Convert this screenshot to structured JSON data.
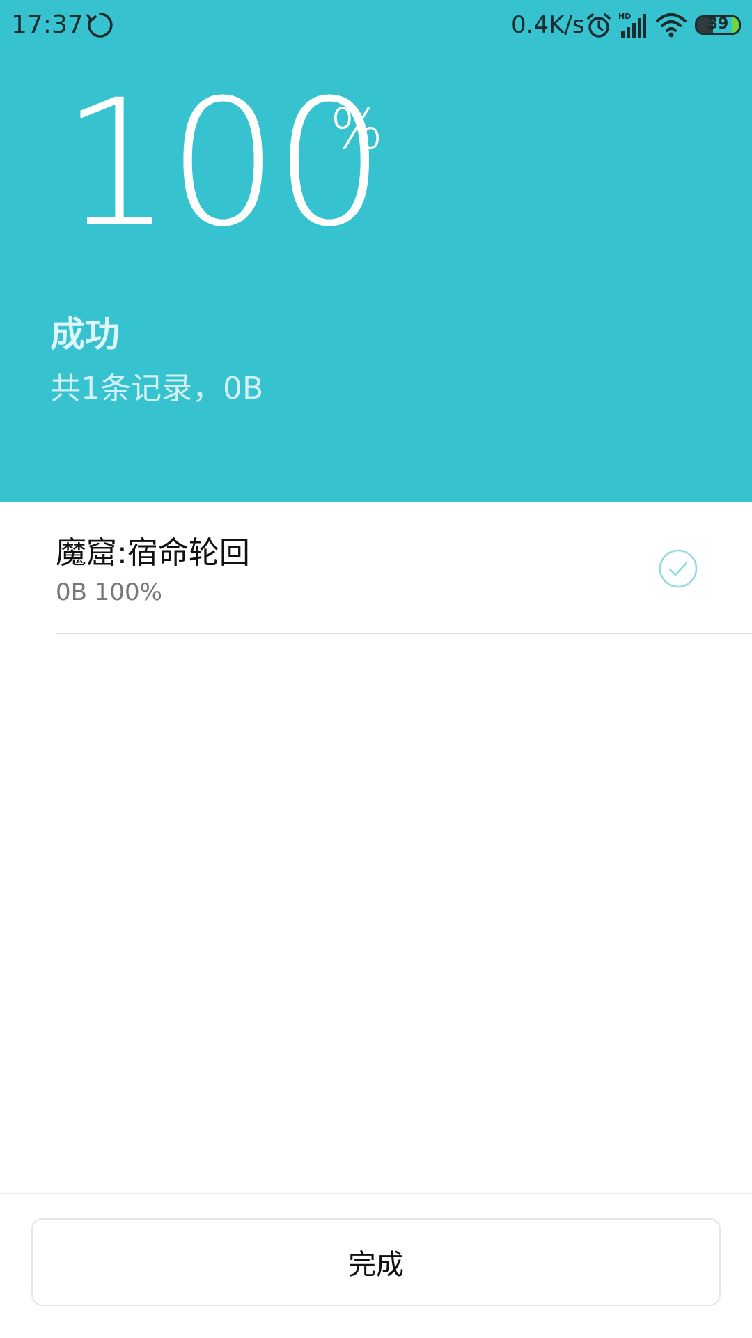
{
  "status_bar": {
    "time": "17:37",
    "net_speed": "0.4K/s",
    "signal_badge": "HD",
    "battery_level": "39",
    "battery_fraction": 0.39,
    "icons": [
      "sync-icon",
      "alarm-icon",
      "signal-icon",
      "wifi-icon",
      "battery-icon"
    ]
  },
  "summary": {
    "percent": "100",
    "percent_sign": "%",
    "status": "成功",
    "detail": "共1条记录，0B"
  },
  "items": [
    {
      "title": "魔窟:宿命轮回",
      "meta": "0B 100%",
      "state_icon": "check-circle-icon"
    }
  ],
  "footer": {
    "done_label": "完成"
  },
  "colors": {
    "header_bg": "#36c3cf",
    "check": "#8fd9df",
    "battery_tip": "#6fd641"
  }
}
